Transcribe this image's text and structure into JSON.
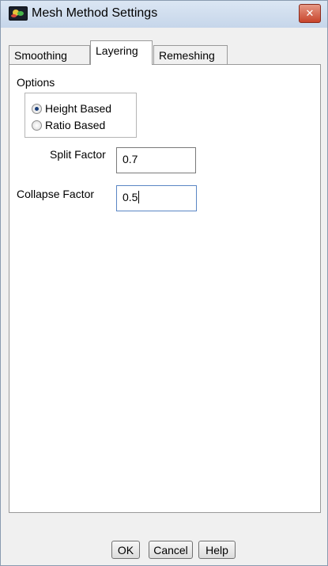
{
  "window": {
    "title": "Mesh Method Settings",
    "close_glyph": "✕",
    "icon": "app-logo-icon"
  },
  "tabs": [
    {
      "label": "Smoothing",
      "active": false
    },
    {
      "label": "Layering",
      "active": true
    },
    {
      "label": "Remeshing",
      "active": false
    }
  ],
  "layering": {
    "options_label": "Options",
    "radio_options": [
      {
        "label": "Height Based",
        "checked": true
      },
      {
        "label": "Ratio Based",
        "checked": false
      }
    ],
    "split_factor": {
      "label": "Split Factor",
      "value": "0.7"
    },
    "collapse_factor": {
      "label": "Collapse Factor",
      "value": "0.5"
    }
  },
  "buttons": {
    "ok": "OK",
    "cancel": "Cancel",
    "help": "Help"
  }
}
